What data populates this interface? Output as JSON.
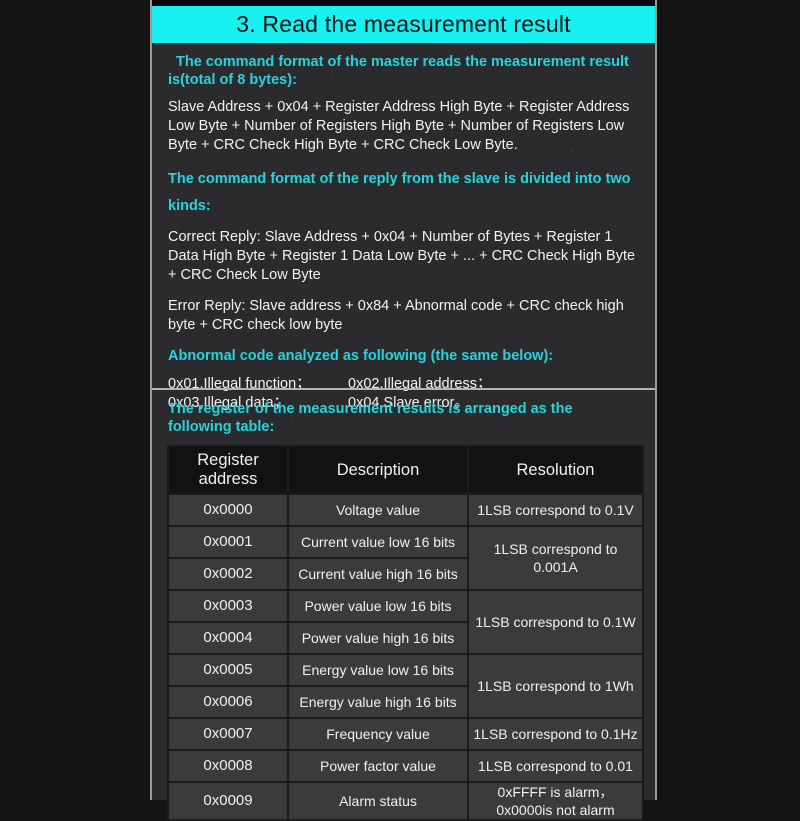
{
  "title_bar": {
    "text": "3. Read the measurement result"
  },
  "sections": {
    "master_heading": "The command format of the master reads the measurement result is(total of 8 bytes):",
    "master_body": "Slave Address + 0x04 + Register Address High Byte + Register Address Low Byte + Number of Registers High Byte + Number of Registers Low Byte + CRC Check High Byte + CRC Check Low Byte.",
    "reply_heading": "The command format of the reply from the slave is divided into two kinds:",
    "correct_reply": "Correct Reply: Slave Address + 0x04 + Number of Bytes + Register 1 Data High Byte + Register 1 Data Low Byte + ... + CRC Check High Byte + CRC Check Low Byte",
    "error_reply": "Error Reply: Slave address + 0x84 + Abnormal code + CRC check high byte + CRC check low byte",
    "abnormal_heading": "Abnormal code analyzed as following (the same below):",
    "abnormal_codes": [
      {
        "left": "0x01,Illegal function；",
        "right": "0x02,Illegal address；"
      },
      {
        "left": "0x03,Illegal data；",
        "right": "0x04,Slave error。"
      }
    ],
    "table_heading": "The register of the measurement results is arranged as the following table:"
  },
  "table": {
    "headers": [
      "Register address",
      "Description",
      "Resolution"
    ],
    "rows": [
      {
        "address": "0x0000",
        "description": "Voltage value",
        "resolution": "1LSB correspond to 0.1V",
        "res_span": 1
      },
      {
        "address": "0x0001",
        "description": "Current value low 16 bits",
        "resolution": "1LSB correspond to 0.001A",
        "res_span": 2
      },
      {
        "address": "0x0002",
        "description": "Current value high 16 bits"
      },
      {
        "address": "0x0003",
        "description": "Power value low 16 bits",
        "resolution": "1LSB correspond to 0.1W",
        "res_span": 2
      },
      {
        "address": "0x0004",
        "description": "Power value high 16 bits"
      },
      {
        "address": "0x0005",
        "description": "Energy value low 16 bits",
        "resolution": "1LSB correspond to 1Wh",
        "res_span": 2
      },
      {
        "address": "0x0006",
        "description": "Energy value high 16 bits"
      },
      {
        "address": "0x0007",
        "description": "Frequency value",
        "resolution": "1LSB correspond to 0.1Hz",
        "res_span": 1
      },
      {
        "address": "0x0008",
        "description": "Power factor value",
        "resolution": "1LSB correspond to 0.01",
        "res_span": 1
      },
      {
        "address": "0x0009",
        "description": "Alarm status",
        "resolution": "0xFFFF is alarm，\n0x0000is not alarm",
        "res_span": 1
      }
    ]
  },
  "colors": {
    "accent_cyan": "#19f1f1",
    "heading_cyan": "#27d3dc",
    "panel_bg": "#2b2b2d",
    "page_bg": "#141414",
    "table_row_bg": "#3b3b3b",
    "table_head_bg": "#121212"
  }
}
